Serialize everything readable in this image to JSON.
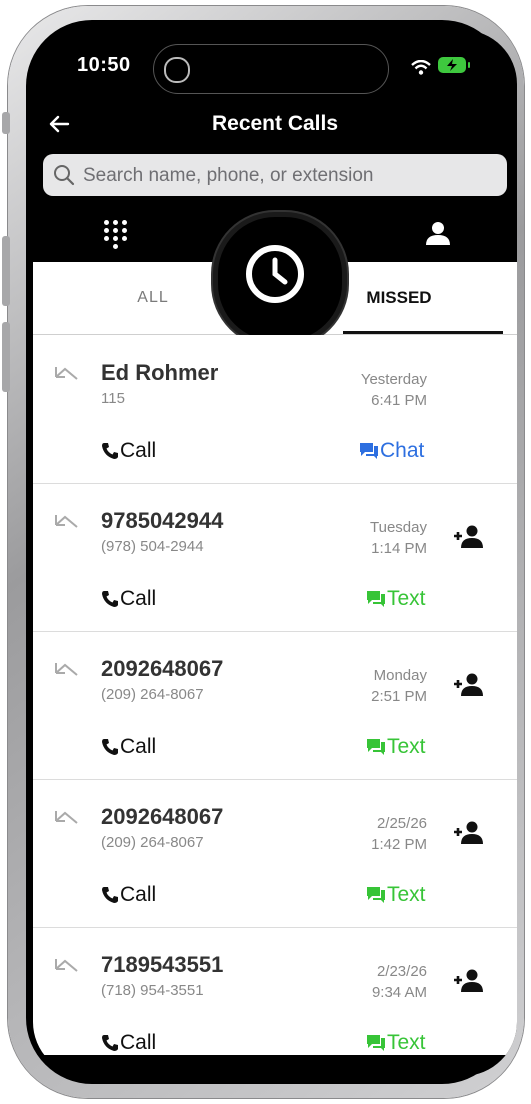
{
  "status_bar": {
    "time": "10:50"
  },
  "header": {
    "title": "Recent Calls",
    "back_icon": "arrow-left-icon"
  },
  "search": {
    "placeholder": "Search name, phone, or extension"
  },
  "tabs": {
    "all": "ALL",
    "missed": "MISSED",
    "active": "MISSED"
  },
  "colors": {
    "chat_blue": "#2d6fe0",
    "text_green": "#37c437",
    "header_black": "#000000"
  },
  "calls": [
    {
      "name": "Ed Rohmer",
      "number": "115",
      "day": "Yesterday",
      "time": "6:41 PM",
      "call_label": "Call",
      "message_label": "Chat",
      "message_type": "chat",
      "add_contact": false
    },
    {
      "name": "9785042944",
      "number": "(978) 504-2944",
      "day": "Tuesday",
      "time": "1:14 PM",
      "call_label": "Call",
      "message_label": "Text",
      "message_type": "text",
      "add_contact": true
    },
    {
      "name": "2092648067",
      "number": "(209) 264-8067",
      "day": "Monday",
      "time": "2:51 PM",
      "call_label": "Call",
      "message_label": "Text",
      "message_type": "text",
      "add_contact": true
    },
    {
      "name": "2092648067",
      "number": "(209) 264-8067",
      "day": "2/25/26",
      "time": "1:42 PM",
      "call_label": "Call",
      "message_label": "Text",
      "message_type": "text",
      "add_contact": true
    },
    {
      "name": "7189543551",
      "number": "(718) 954-3551",
      "day": "2/23/26",
      "time": "9:34 AM",
      "call_label": "Call",
      "message_label": "Text",
      "message_type": "text",
      "add_contact": true
    }
  ]
}
